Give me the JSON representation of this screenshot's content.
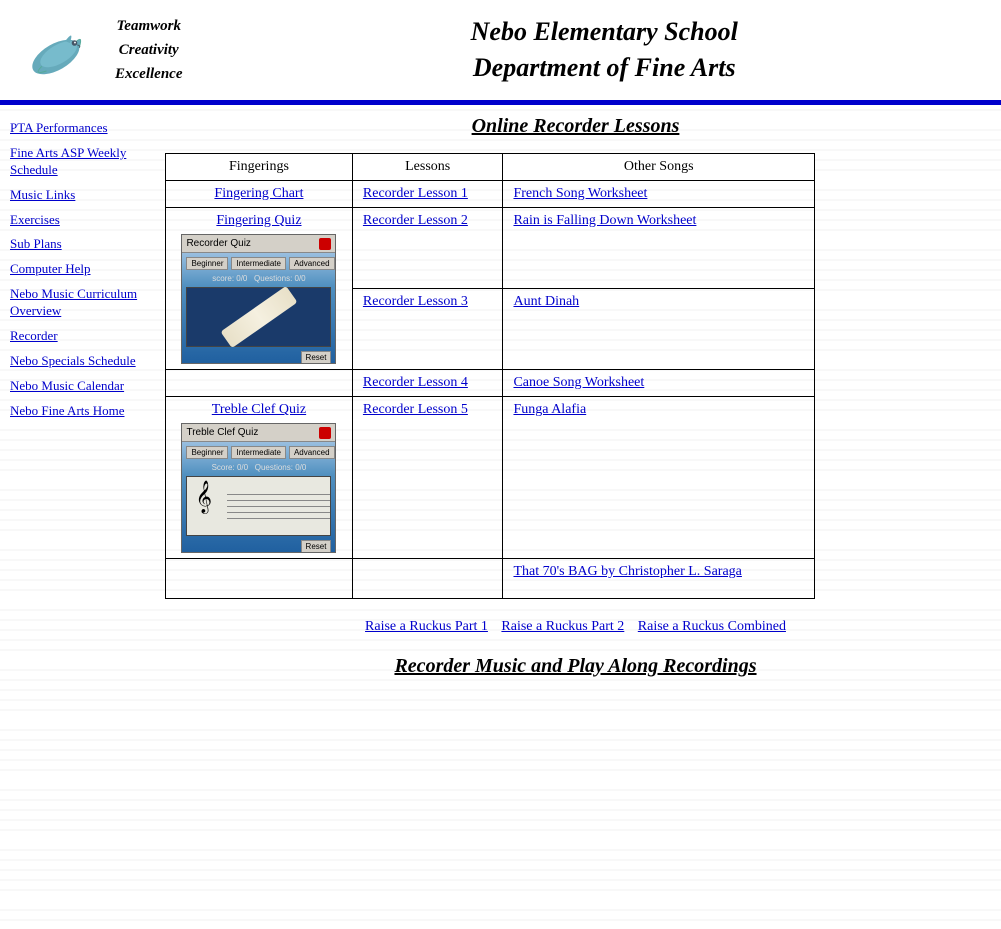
{
  "header": {
    "motto_line1": "Teamwork",
    "motto_line2": "Creativity",
    "motto_line3": "Excellence",
    "title_line1": "Nebo Elementary School",
    "title_line2": "Department of Fine Arts"
  },
  "sidebar": {
    "links": [
      {
        "id": "pta-performances",
        "label": "PTA Performances"
      },
      {
        "id": "fine-arts-asp",
        "label": "Fine Arts ASP Weekly Schedule"
      },
      {
        "id": "music-links",
        "label": "Music Links"
      },
      {
        "id": "exercises",
        "label": "Exercises"
      },
      {
        "id": "sub-plans",
        "label": "Sub Plans"
      },
      {
        "id": "computer-help",
        "label": "Computer Help"
      },
      {
        "id": "nebo-music-curriculum",
        "label": "Nebo Music Curriculum Overview"
      },
      {
        "id": "recorder",
        "label": "Recorder"
      },
      {
        "id": "nebo-specials-schedule",
        "label": "Nebo Specials Schedule"
      },
      {
        "id": "nebo-music-calendar",
        "label": "Nebo Music Calendar"
      },
      {
        "id": "nebo-fine-arts-home",
        "label": "Nebo Fine Arts Home"
      }
    ]
  },
  "content": {
    "page_title": "Online Recorder Lessons",
    "table": {
      "headers": [
        "Fingerings",
        "Lessons",
        "Other Songs"
      ],
      "fingerings": [
        {
          "label": "Fingering Chart",
          "type": "link"
        },
        {
          "label": "Fingering Quiz",
          "type": "quiz",
          "quiz_title": "Recorder Quiz"
        },
        {
          "label": "Treble Clef Quiz",
          "type": "treble_quiz",
          "quiz_title": "Treble Clef Quiz"
        },
        {
          "label": "",
          "type": "empty"
        }
      ],
      "lessons": [
        {
          "label": "Recorder Lesson 1"
        },
        {
          "label": "Recorder Lesson 2"
        },
        {
          "label": "Recorder Lesson 3"
        },
        {
          "label": "Recorder Lesson 4"
        },
        {
          "label": "Recorder Lesson 5"
        },
        {
          "label": ""
        }
      ],
      "other_songs": [
        {
          "label": "French Song Worksheet"
        },
        {
          "label": "Rain is Falling Down Worksheet"
        },
        {
          "label": "Aunt Dinah"
        },
        {
          "label": "Canoe Song Worksheet"
        },
        {
          "label": "Funga Alafia"
        },
        {
          "label": "That 70's BAG by Christopher L. Saraga"
        }
      ]
    },
    "ruckus_links": [
      {
        "label": "Raise a Ruckus Part 1"
      },
      {
        "label": "Raise a Ruckus Part 2"
      },
      {
        "label": "Raise a Ruckus Combined"
      }
    ],
    "recordings_title": "Recorder Music and Play Along Recordings"
  }
}
